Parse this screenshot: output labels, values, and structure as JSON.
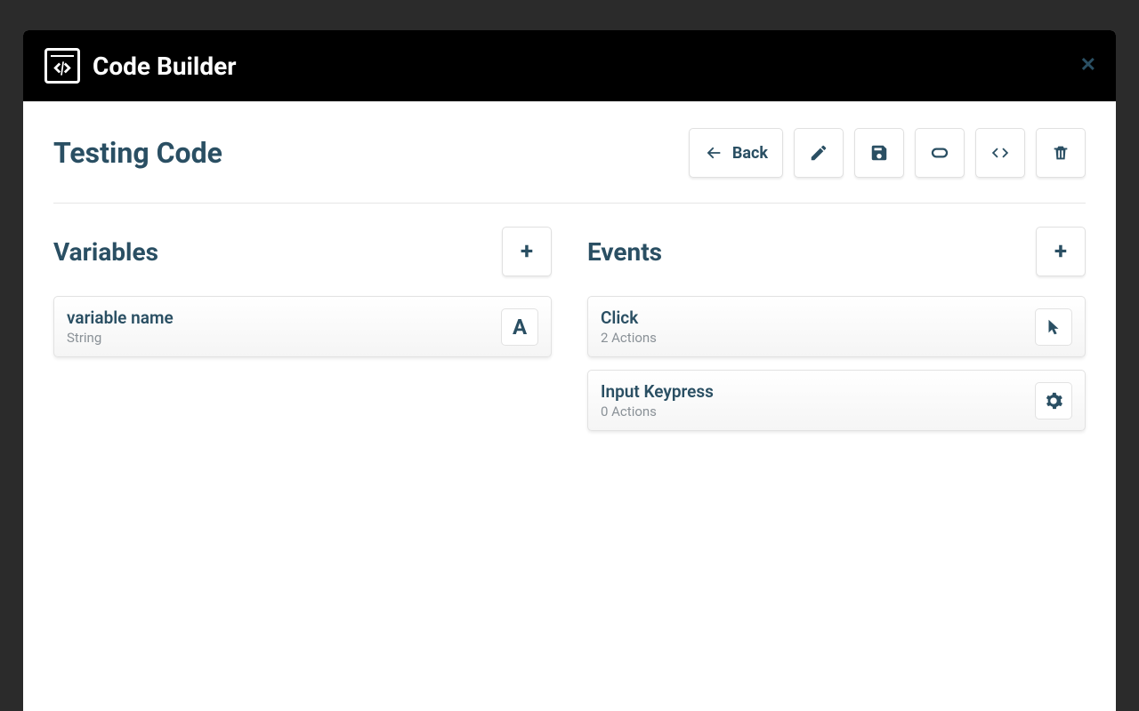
{
  "header": {
    "app_title": "Code Builder"
  },
  "page": {
    "title": "Testing Code"
  },
  "toolbar": {
    "back_label": "Back"
  },
  "variables": {
    "heading": "Variables",
    "items": [
      {
        "name": "variable name",
        "type": "String",
        "type_badge": "A"
      }
    ]
  },
  "events": {
    "heading": "Events",
    "items": [
      {
        "name": "Click",
        "subtitle": "2 Actions",
        "icon": "cursor"
      },
      {
        "name": "Input Keypress",
        "subtitle": "0 Actions",
        "icon": "gear"
      }
    ]
  }
}
